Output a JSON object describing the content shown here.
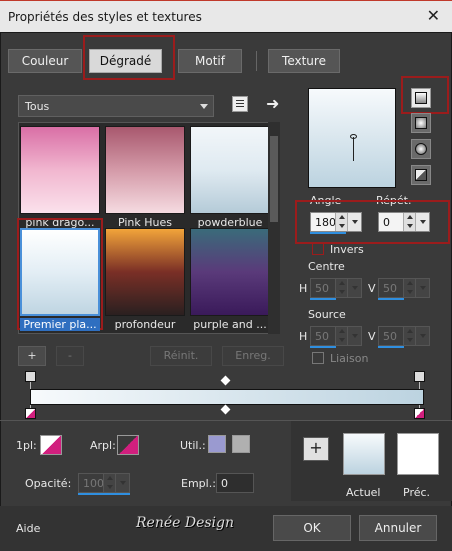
{
  "window": {
    "title": "Propriétés des styles et textures"
  },
  "tabs": [
    {
      "label": "Couleur"
    },
    {
      "label": "Dégradé"
    },
    {
      "label": "Motif"
    },
    {
      "label": "Texture"
    }
  ],
  "filter": {
    "value": "Tous"
  },
  "gradients": [
    {
      "label": "pink drago...",
      "colors": [
        "#d96fa6",
        "#f1b6cf",
        "#fbe1ec"
      ]
    },
    {
      "label": "Pink Hues",
      "colors": [
        "#a8586e",
        "#d49aa8",
        "#f5dbe1"
      ]
    },
    {
      "label": "powderblue",
      "colors": [
        "#f2f6f9",
        "#dfeaf1",
        "#b5cbd8"
      ]
    },
    {
      "label": "Premier pla...",
      "colors": [
        "#ffffff",
        "#e3eef5",
        "#bfd5e2"
      ]
    },
    {
      "label": "profondeur",
      "colors": [
        "#f2a43a",
        "#7a2f26",
        "#2a2020"
      ]
    },
    {
      "label": "purple and ...",
      "colors": [
        "#3a6b7a",
        "#5a3a7a",
        "#3a1a5a"
      ]
    }
  ],
  "library_buttons": {
    "add": "+",
    "remove": "-",
    "reinit": "Réinit.",
    "save": "Enreg."
  },
  "angle": {
    "label": "Angle",
    "value": "180"
  },
  "repeat": {
    "label": "Répét.",
    "value": "0"
  },
  "invert": {
    "label": "Invers"
  },
  "centre": {
    "label": "Centre",
    "h_label": "H",
    "h_value": "50",
    "v_label": "V",
    "v_value": "50"
  },
  "source": {
    "label": "Source",
    "h_label": "H",
    "h_value": "50",
    "v_label": "V",
    "v_value": "50"
  },
  "link": {
    "label": "Liaison"
  },
  "markers": {
    "fg_label": "1pl:",
    "fg_color": "#d11f7e",
    "bg_label": "Arpl:",
    "bg_color": "#d11f7e",
    "user_label": "Util.:",
    "user_color_1": "#9a9ad0",
    "user_color_2": "#b0b0b0",
    "opacity_label": "Opacité:",
    "opacity_value": "100",
    "location_label": "Empl.:",
    "location_value": "0"
  },
  "preview_panel": {
    "add": "+",
    "current_label": "Actuel",
    "previous_label": "Préc."
  },
  "footer": {
    "help": "Aide",
    "logo": "Renée Design",
    "ok": "OK",
    "cancel": "Annuler"
  }
}
